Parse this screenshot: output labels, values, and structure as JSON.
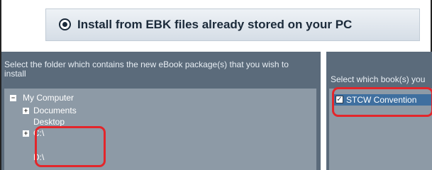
{
  "install_option": {
    "label": "Install from EBK files already stored on your PC"
  },
  "folder_panel": {
    "instruction": "Select the folder which contains the new eBook package(s) that you wish to install",
    "tree": [
      {
        "label": "My Computer",
        "expander": "−"
      },
      {
        "label": "Documents",
        "expander": "+"
      },
      {
        "label": "Desktop",
        "expander": ""
      },
      {
        "label": "C:\\",
        "expander": "+"
      },
      {
        "label": "D:\\",
        "expander": ""
      }
    ]
  },
  "book_panel": {
    "instruction": "Select which book(s) you",
    "items": [
      {
        "label": "STCW Convention",
        "checked": true
      }
    ]
  },
  "colors": {
    "panel_bg": "#5b6b7b",
    "tree_bg": "#8d9aa6",
    "highlight": "#e3262b"
  }
}
